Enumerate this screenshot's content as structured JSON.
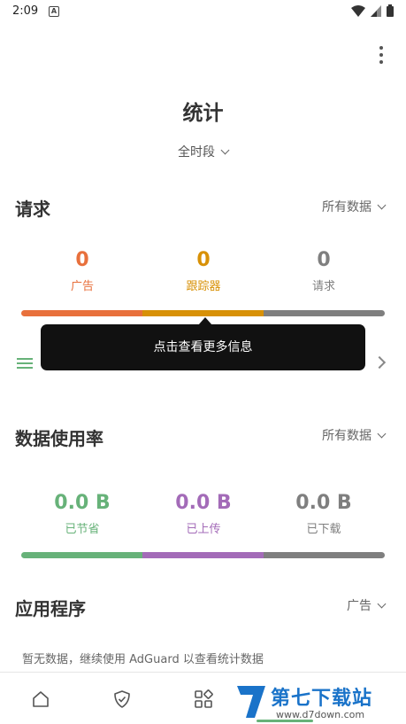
{
  "status_bar": {
    "time": "2:09",
    "notif_letter": "A"
  },
  "header": {
    "title": "统计",
    "period": "全时段"
  },
  "requests": {
    "title": "请求",
    "filter": "所有数据",
    "stats": [
      {
        "value": "0",
        "label": "广告",
        "color": "#e8703c"
      },
      {
        "value": "0",
        "label": "跟踪器",
        "color": "#d89107"
      },
      {
        "value": "0",
        "label": "请求",
        "color": "#7f7f7f"
      }
    ]
  },
  "tooltip": {
    "text": "点击查看更多信息"
  },
  "data_usage": {
    "title": "数据使用率",
    "filter": "所有数据",
    "stats": [
      {
        "value": "0.0 B",
        "label": "已节省",
        "color": "#67b279"
      },
      {
        "value": "0.0 B",
        "label": "已上传",
        "color": "#a36bb8"
      },
      {
        "value": "0.0 B",
        "label": "已下载",
        "color": "#7f7f7f"
      }
    ]
  },
  "apps": {
    "title": "应用程序",
    "filter": "广告",
    "empty_text": "暂无数据，继续使用 AdGuard 以查看统计数据"
  },
  "watermark": {
    "name": "第七下载站",
    "url": "www.d7down.com"
  }
}
